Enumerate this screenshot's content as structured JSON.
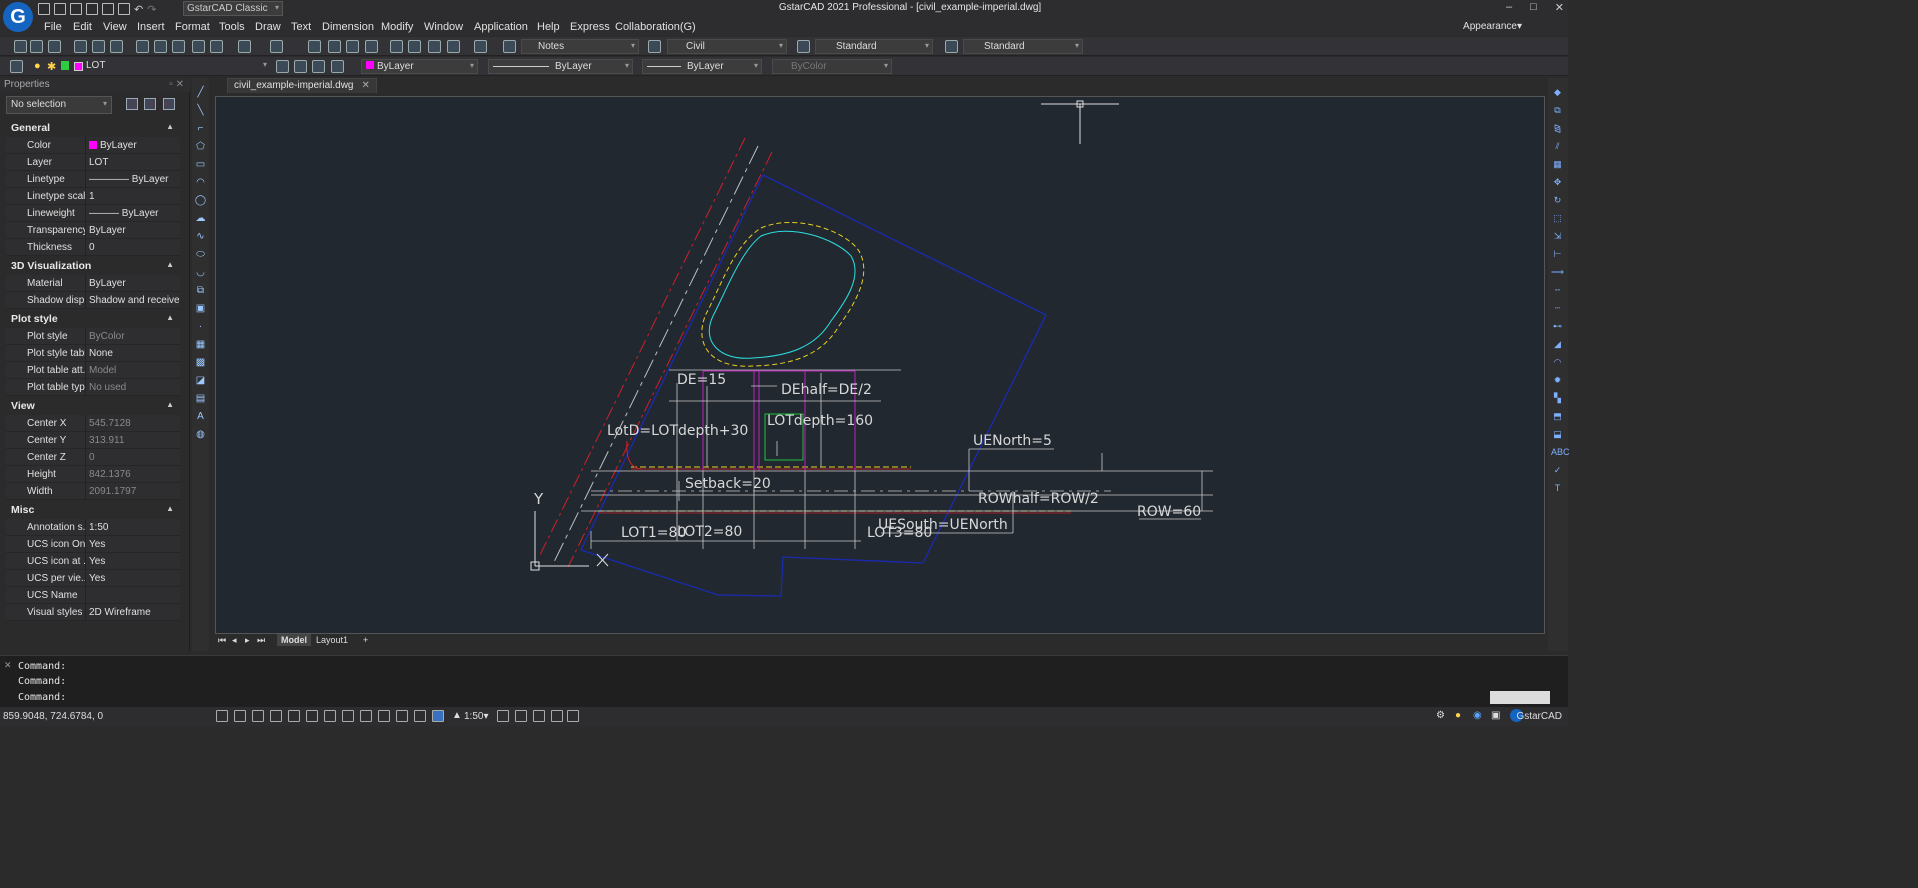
{
  "app": {
    "window_title": "GstarCAD 2021 Professional - [civil_example-imperial.dwg]",
    "logo_letter": "G",
    "workspace": "GstarCAD Classic",
    "window_controls": [
      "–",
      "□",
      "✕"
    ]
  },
  "menu": [
    "File",
    "Edit",
    "View",
    "Insert",
    "Format",
    "Tools",
    "Draw",
    "Text",
    "Dimension",
    "Modify",
    "Window",
    "Application",
    "Help",
    "Express",
    "Collaboration(G)"
  ],
  "appearance": "Appearance▾",
  "toolbar1": {
    "text_style": "Notes",
    "dim_style": "Civil",
    "table_style": "Standard",
    "multileader_style": "Standard"
  },
  "toolbar2": {
    "layer": "LOT",
    "color": "ByLayer",
    "linetype": "ByLayer",
    "lineweight": "ByLayer",
    "plotstyle": "ByColor"
  },
  "properties": {
    "title": "Properties",
    "selection": "No selection",
    "sections": [
      {
        "name": "General",
        "rows": [
          {
            "k": "Color",
            "v": "ByLayer",
            "swatch": "#ff00ff"
          },
          {
            "k": "Layer",
            "v": "LOT"
          },
          {
            "k": "Linetype",
            "v": "———— ByLayer"
          },
          {
            "k": "Linetype scale",
            "v": "1"
          },
          {
            "k": "Lineweight",
            "v": "——— ByLayer"
          },
          {
            "k": "Transparency",
            "v": "ByLayer"
          },
          {
            "k": "Thickness",
            "v": "0"
          }
        ]
      },
      {
        "name": "3D Visualization",
        "rows": [
          {
            "k": "Material",
            "v": "ByLayer"
          },
          {
            "k": "Shadow disp...",
            "v": "Shadow and receive ..."
          }
        ]
      },
      {
        "name": "Plot style",
        "rows": [
          {
            "k": "Plot style",
            "v": "ByColor",
            "grey": true
          },
          {
            "k": "Plot style table",
            "v": "None"
          },
          {
            "k": "Plot table att...",
            "v": "Model",
            "grey": true
          },
          {
            "k": "Plot table type",
            "v": "No used",
            "grey": true
          }
        ]
      },
      {
        "name": "View",
        "rows": [
          {
            "k": "Center X",
            "v": "545.7128",
            "grey": true
          },
          {
            "k": "Center Y",
            "v": "313.911",
            "grey": true
          },
          {
            "k": "Center Z",
            "v": "0",
            "grey": true
          },
          {
            "k": "Height",
            "v": "842.1376",
            "grey": true
          },
          {
            "k": "Width",
            "v": "2091.1797",
            "grey": true
          }
        ]
      },
      {
        "name": "Misc",
        "rows": [
          {
            "k": "Annotation s...",
            "v": "1:50"
          },
          {
            "k": "UCS icon On",
            "v": "Yes"
          },
          {
            "k": "UCS icon at ...",
            "v": "Yes"
          },
          {
            "k": "UCS per vie...",
            "v": "Yes"
          },
          {
            "k": "UCS Name",
            "v": ""
          },
          {
            "k": "Visual styles",
            "v": "2D Wireframe"
          }
        ]
      }
    ]
  },
  "document_tab": "civil_example-imperial.dwg",
  "drawing_labels": {
    "de": "DE=15",
    "dehalf": "DEhalf=DE/2",
    "lotd": "LotD=LOTdepth+30",
    "lotdepth": "LOTdepth=160",
    "uenorth": "UENorth=5",
    "setback": "Setback=20",
    "rowhalf": "ROWhalf=ROW/2",
    "row": "ROW=60",
    "uesouth": "UESouth=UENorth",
    "lot1": "LOT1=80",
    "lot2": "LOT2=80",
    "lot3": "LOT3=80",
    "axis_y": "Y",
    "axis_x": "X"
  },
  "layout_tabs": {
    "model": "Model",
    "layout1": "Layout1",
    "add": "+"
  },
  "command_lines": [
    "Command:",
    "Command:",
    "Command:"
  ],
  "status": {
    "coords": "859.9048, 724.6784, 0",
    "annoscale": "1:50▾",
    "brand": "GstarCAD"
  }
}
